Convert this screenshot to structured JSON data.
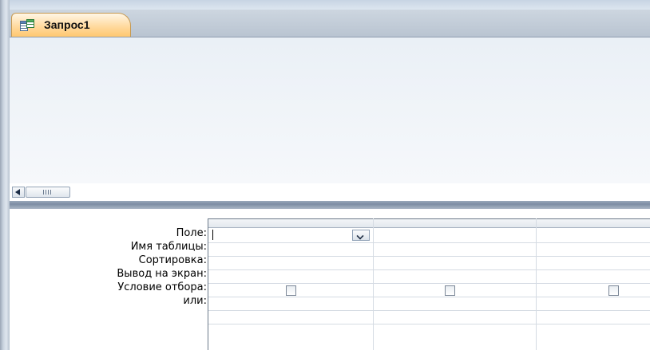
{
  "tab": {
    "title": "Запрос1",
    "icon": "query-icon"
  },
  "grid": {
    "row_labels": [
      "Поле:",
      "Имя таблицы:",
      "Сортировка:",
      "Вывод на экран:",
      "Условие отбора:",
      "или:"
    ],
    "columns": [
      {
        "field": "",
        "table": "",
        "sort": "",
        "show": false,
        "criteria": "",
        "or": ""
      },
      {
        "field": "",
        "table": "",
        "sort": "",
        "show": false,
        "criteria": "",
        "or": ""
      },
      {
        "field": "",
        "table": "",
        "sort": "",
        "show": false,
        "criteria": "",
        "or": ""
      }
    ]
  },
  "colors": {
    "tab_active": "#ffd89a",
    "pane_bg": "#eef2f7",
    "splitter": "#8493a8"
  }
}
